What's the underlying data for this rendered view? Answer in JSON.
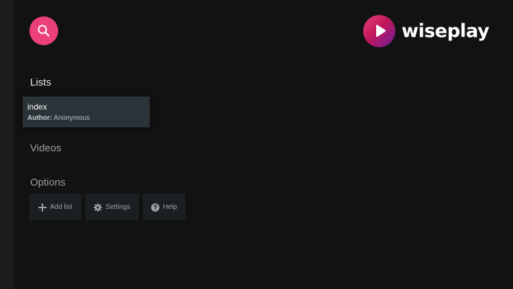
{
  "brand": {
    "name": "wiseplay",
    "accent_color": "#ec407a"
  },
  "search": {
    "icon": "search-icon"
  },
  "sections": {
    "lists": "Lists",
    "videos": "Videos",
    "options": "Options"
  },
  "lists": [
    {
      "title": "index",
      "author_label": "Author:",
      "author": "Anonymous"
    }
  ],
  "options": {
    "add_list": "Add list",
    "settings": "Settings",
    "help": "Help"
  }
}
